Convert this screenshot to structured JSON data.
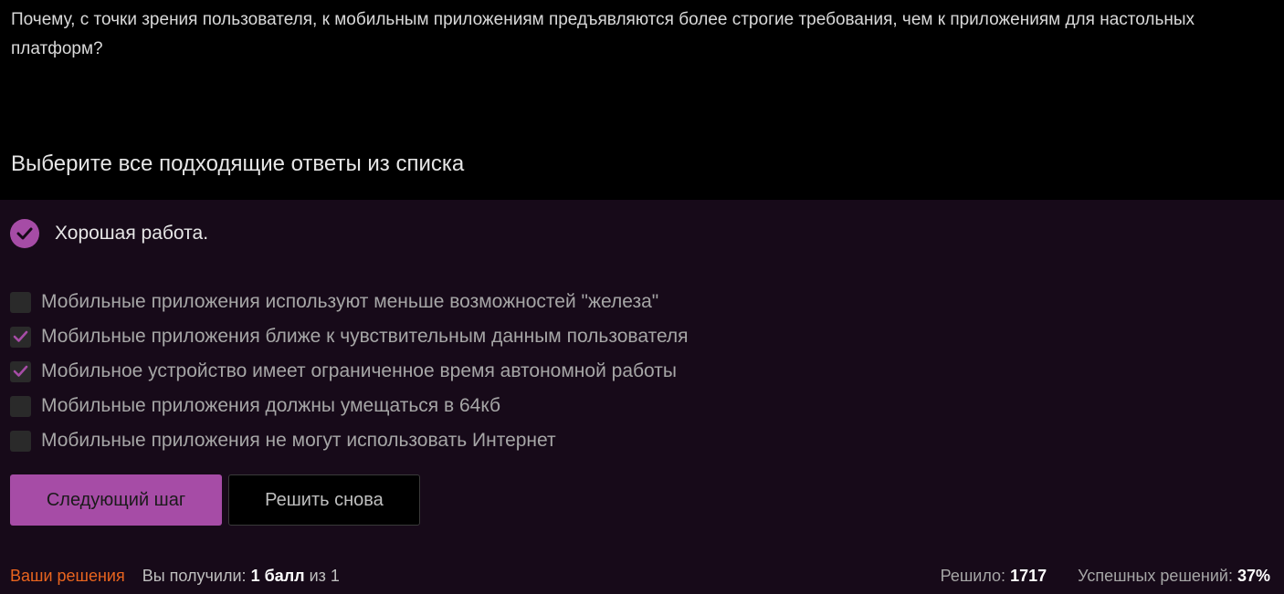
{
  "question": {
    "text": "Почему, с точки зрения пользователя, к мобильным приложениям предъявляются более строгие требования, чем к приложениям для настольных платформ?"
  },
  "prompt": "Выберите все подходящие ответы из списка",
  "feedback": {
    "icon": "check-circle-icon",
    "text": "Хорошая работа."
  },
  "options": [
    {
      "label": "Мобильные приложения используют меньше возможностей \"железа\"",
      "checked": false
    },
    {
      "label": "Мобильные приложения ближе к чувствительным данным пользователя",
      "checked": true
    },
    {
      "label": "Мобильное устройство имеет ограниченное время автономной работы",
      "checked": true
    },
    {
      "label": "Мобильные приложения должны умещаться в 64кб",
      "checked": false
    },
    {
      "label": "Мобильные приложения не могут использовать Интернет",
      "checked": false
    }
  ],
  "buttons": {
    "next": "Следующий шаг",
    "retry": "Решить снова"
  },
  "footer": {
    "solutions_link": "Ваши решения",
    "score_prefix": "Вы получили:",
    "score_value": "1 балл",
    "score_suffix": "из 1",
    "solved_label": "Решило:",
    "solved_value": "1717",
    "success_label": "Успешных решений:",
    "success_value": "37%"
  },
  "colors": {
    "accent": "#a64ca6",
    "panel_bg": "#170a19",
    "page_bg": "#000000",
    "link": "#e8641e"
  }
}
